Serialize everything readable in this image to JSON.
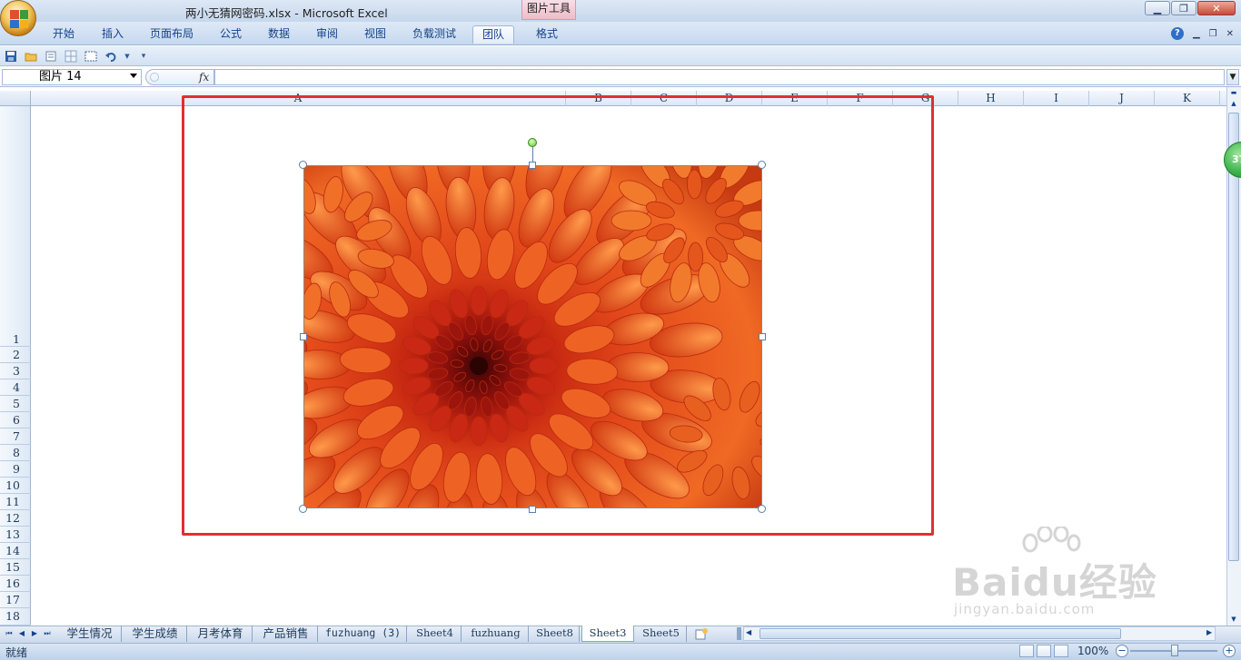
{
  "window": {
    "title": "两小无猜网密码.xlsx - Microsoft Excel",
    "context_tab": "图片工具"
  },
  "ribbon": {
    "tabs": [
      {
        "label": "开始"
      },
      {
        "label": "插入"
      },
      {
        "label": "页面布局"
      },
      {
        "label": "公式"
      },
      {
        "label": "数据"
      },
      {
        "label": "审阅"
      },
      {
        "label": "视图"
      },
      {
        "label": "负载测试"
      },
      {
        "label": "团队"
      },
      {
        "label": "格式"
      }
    ],
    "active_tab": "团队"
  },
  "formula_bar": {
    "name_box": "图片 14",
    "fx": "fx",
    "formula": ""
  },
  "columns": [
    "A",
    "B",
    "C",
    "D",
    "E",
    "F",
    "G",
    "H",
    "I",
    "J",
    "K"
  ],
  "rows": [
    "1",
    "2",
    "3",
    "4",
    "5",
    "6",
    "7",
    "8",
    "9",
    "10",
    "11",
    "12",
    "13",
    "14",
    "15",
    "16",
    "17",
    "18"
  ],
  "picture": {
    "name": "图片 14",
    "subject": "orange chrysanthemum flower"
  },
  "side_badge": "37",
  "sheets": [
    "学生情况",
    "学生成绩",
    "月考体育",
    "产品销售",
    "fuzhuang (3)",
    "Sheet4",
    "fuzhuang",
    "Sheet8",
    "Sheet3",
    "Sheet5"
  ],
  "active_sheet": "Sheet3",
  "status": {
    "text": "就绪",
    "zoom": "100%",
    "zoom_minus": "−",
    "zoom_plus": "+"
  },
  "watermark": {
    "brand": "Baidu经验",
    "url": "jingyan.baidu.com"
  },
  "colors": {
    "selection_border": "#e03030",
    "ribbon": "#c5d8ef",
    "flower_primary": "#e0461a",
    "flower_center": "#a8120f"
  }
}
